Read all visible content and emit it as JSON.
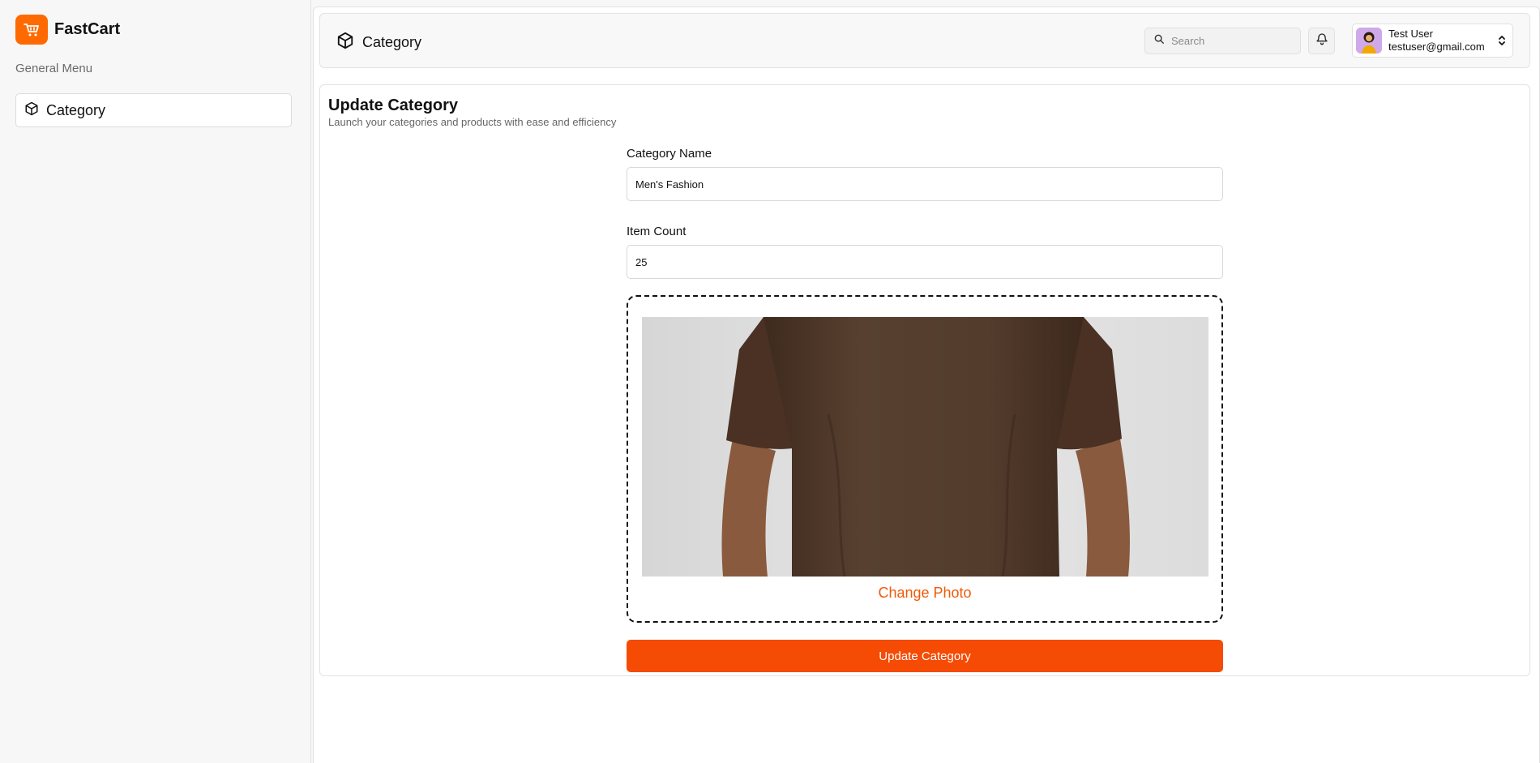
{
  "brand": {
    "name": "FastCart",
    "accent": "#ff6a00"
  },
  "sidebar": {
    "heading": "General Menu",
    "items": [
      {
        "label": "Category",
        "icon": "package-icon"
      }
    ]
  },
  "header": {
    "title": "Category",
    "search_placeholder": "Search",
    "user": {
      "name": "Test User",
      "email": "testuser@gmail.com"
    }
  },
  "page": {
    "title": "Update Category",
    "subtitle": "Launch your categories and products with ease and efficiency"
  },
  "form": {
    "category_name_label": "Category Name",
    "category_name_value": "Men's Fashion",
    "item_count_label": "Item Count",
    "item_count_value": "25",
    "change_photo_label": "Change Photo",
    "submit_label": "Update Category",
    "submit_color": "#f54b05"
  }
}
